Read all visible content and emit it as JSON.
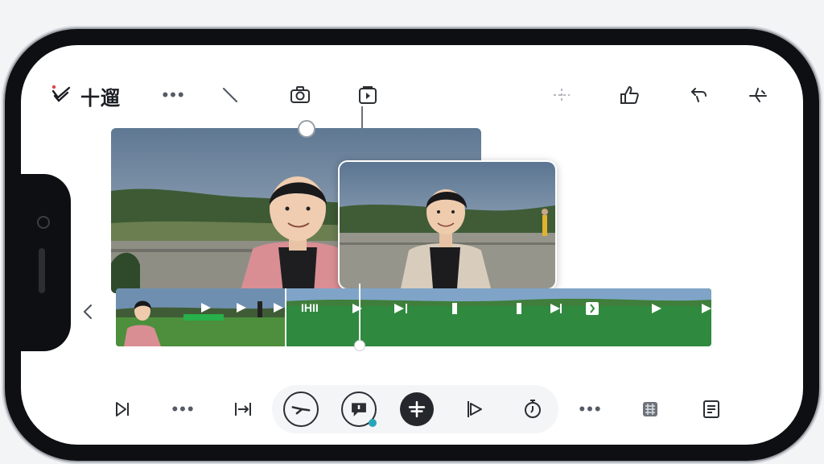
{
  "app": {
    "title": "十遛"
  },
  "top_toolbar": {
    "icons": [
      "brand-check-icon",
      "more-icon",
      "slash-tool-icon",
      "camera-icon",
      "media-frame-icon",
      "split-icon",
      "thumbs-up-icon",
      "undo-icon",
      "sparkle-icon"
    ],
    "more_label": "•••"
  },
  "timeline": {
    "marker_text": "IHII"
  },
  "bottom_toolbar": {
    "more_left_label": "•••",
    "more_right_label": "•••",
    "icons": [
      "skip-to-end-icon",
      "more-icon",
      "trim-icon",
      "transition-icon",
      "comment-bubble-icon",
      "add-icon",
      "play-effect-icon",
      "timer-icon",
      "more-icon",
      "sticker-icon",
      "notes-icon"
    ]
  },
  "colors": {
    "timeline_green": "#2f8a3f",
    "ink": "#1b1d22",
    "accent_red": "#e0444b",
    "accent_teal": "#2aa5b8"
  }
}
